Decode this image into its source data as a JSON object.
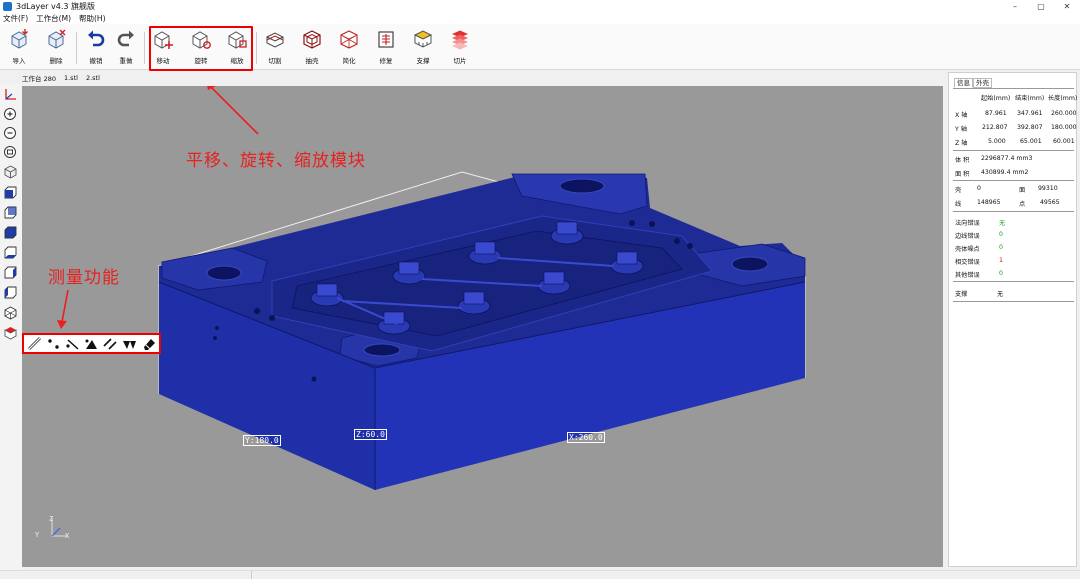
{
  "window": {
    "title": "3dLayer v4.3 旗舰版",
    "controls": [
      "–",
      "▢",
      "✕"
    ]
  },
  "menu": [
    "文件(F)",
    "工作台(M)",
    "帮助(H)"
  ],
  "toolbar": {
    "items": [
      {
        "label": "导入",
        "icon": "import-icon"
      },
      {
        "label": "删除",
        "icon": "delete-icon"
      },
      {
        "label": "撤销",
        "icon": "undo-icon"
      },
      {
        "label": "重做",
        "icon": "redo-icon"
      },
      {
        "label": "移动",
        "icon": "move-icon"
      },
      {
        "label": "旋转",
        "icon": "rotate-icon"
      },
      {
        "label": "缩放",
        "icon": "scale-icon"
      },
      {
        "label": "切割",
        "icon": "cut-icon"
      },
      {
        "label": "抽壳",
        "icon": "shell-icon"
      },
      {
        "label": "简化",
        "icon": "simplify-icon"
      },
      {
        "label": "修复",
        "icon": "repair-icon"
      },
      {
        "label": "支撑",
        "icon": "support-icon"
      },
      {
        "label": "切片",
        "icon": "slice-icon"
      }
    ]
  },
  "tabs": [
    "工作台 280",
    "1.stl",
    "2.stl"
  ],
  "annotations": {
    "transform": "平移、旋转、缩放模块",
    "measure": "测量功能"
  },
  "dimensions": {
    "y": "Y:180.0",
    "z": "Z:60.0",
    "x": "X:260.0"
  },
  "axis": {
    "x": "X",
    "y": "Y",
    "z": "Z"
  },
  "info_panel": {
    "tabs": [
      "信息",
      "外壳"
    ],
    "headers": [
      "起始(mm)",
      "结束(mm)",
      "长度(mm)"
    ],
    "axes": [
      {
        "name": "X 轴",
        "start": "87.961",
        "end": "347.961",
        "length": "260.000"
      },
      {
        "name": "Y 轴",
        "start": "212.807",
        "end": "392.807",
        "length": "180.000"
      },
      {
        "name": "Z 轴",
        "start": "5.000",
        "end": "65.001",
        "length": "60.001"
      }
    ],
    "volume_label": "体 积",
    "volume": "2296877.4 mm3",
    "area_label": "面 积",
    "area": "430899.4 mm2",
    "shell_label": "壳",
    "shell": "0",
    "face_label": "面",
    "face": "99310",
    "edge_label": "线",
    "edge": "148965",
    "point_label": "点",
    "point": "49565",
    "errors": [
      {
        "label": "法向错误",
        "value": "无",
        "color": "#1a9a1a"
      },
      {
        "label": "边线错误",
        "value": "0",
        "color": "#1a9a1a"
      },
      {
        "label": "壳体噪点",
        "value": "0",
        "color": "#1a9a1a"
      },
      {
        "label": "相交错误",
        "value": "1",
        "color": "#d01010"
      },
      {
        "label": "其他错误",
        "value": "0",
        "color": "#1a9a1a"
      }
    ],
    "support_label": "支撑",
    "support": "无"
  },
  "colors": {
    "model": "#1f2a9a",
    "viewport": "#999999",
    "annotation": "#e82020"
  }
}
